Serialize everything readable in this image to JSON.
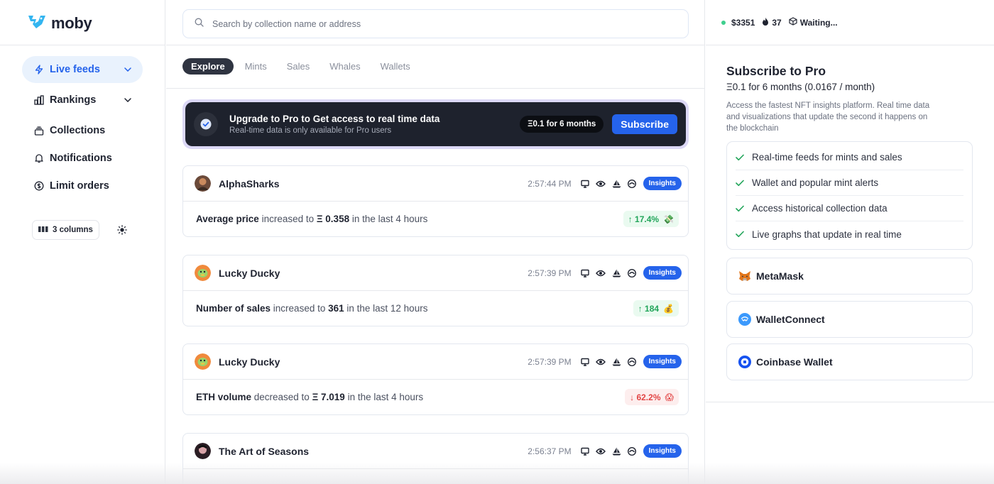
{
  "brand": {
    "name": "moby"
  },
  "sidebar": {
    "items": [
      {
        "label": "Live feeds"
      },
      {
        "label": "Rankings"
      },
      {
        "label": "Collections"
      },
      {
        "label": "Notifications"
      },
      {
        "label": "Limit orders"
      }
    ],
    "columns_label": "3 columns"
  },
  "search": {
    "placeholder": "Search by collection name or address"
  },
  "tabs": [
    "Explore",
    "Mints",
    "Sales",
    "Whales",
    "Wallets"
  ],
  "promo": {
    "title": "Upgrade to Pro to Get access to real time data",
    "subtitle": "Real-time data is only available for Pro users",
    "price": "Ξ0.1 for 6 months",
    "button": "Subscribe"
  },
  "feed": [
    {
      "name": "AlphaSharks",
      "time": "2:57:44 PM",
      "insights": "Insights",
      "metric": "Average price",
      "verb": " increased to ",
      "value": "Ξ 0.358",
      "tail": " in the last 4 hours",
      "change": "↑ 17.4%",
      "emoji": "💸",
      "direction": "up"
    },
    {
      "name": "Lucky Ducky",
      "time": "2:57:39 PM",
      "insights": "Insights",
      "metric": "Number of sales",
      "verb": " increased to ",
      "value": "361",
      "tail": " in the last 12 hours",
      "change": "↑ 184",
      "emoji": "💰",
      "direction": "up"
    },
    {
      "name": "Lucky Ducky",
      "time": "2:57:39 PM",
      "insights": "Insights",
      "metric": "ETH volume",
      "verb": " decreased to ",
      "value": "Ξ 7.019",
      "tail": " in the last 4 hours",
      "change": "↓ 62.2%",
      "emoji": "😱",
      "direction": "down"
    },
    {
      "name": "The Art of Seasons",
      "time": "2:56:37 PM",
      "insights": "Insights"
    }
  ],
  "status": {
    "price": "$3351",
    "gas": "37",
    "block": "Waiting..."
  },
  "pro": {
    "title": "Subscribe to Pro",
    "price": "Ξ0.1 for 6 months (0.0167 / month)",
    "description": "Access the fastest NFT insights platform. Real time data and visualizations that update the second it happens on the blockchain",
    "features": [
      "Real-time feeds for mints and sales",
      "Wallet and popular mint alerts",
      "Access historical collection data",
      "Live graphs that update in real time"
    ]
  },
  "wallets": [
    "MetaMask",
    "WalletConnect",
    "Coinbase Wallet"
  ],
  "colors": {
    "accent": "#2563eb",
    "positive": "#22a55a",
    "negative": "#e24545",
    "dark": "#1e222d"
  }
}
